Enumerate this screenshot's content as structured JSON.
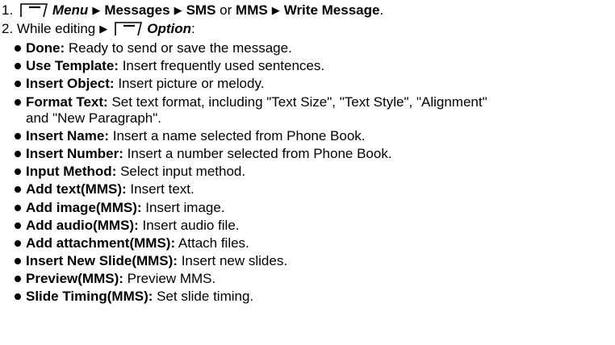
{
  "steps": {
    "one": {
      "number": "1.",
      "menu": "Menu",
      "messages": "Messages",
      "sms": "SMS",
      "or": "or",
      "mms": "MMS",
      "write_message": "Write Message",
      "end": "."
    },
    "two": {
      "number": "2.",
      "while_editing": "While editing",
      "option": "Option",
      "end": ":"
    }
  },
  "options": [
    {
      "term": "Done:",
      "desc": "Ready to send or save the message."
    },
    {
      "term": "Use Template:",
      "desc": "Insert frequently used sentences."
    },
    {
      "term": "Insert Object:",
      "desc": "Insert picture or melody."
    },
    {
      "term": "Format Text:",
      "desc": "Set text format, including \"Text Size\", \"Text Style\", \"Alignment\"",
      "desc2": "and \"New Paragraph\"."
    },
    {
      "term": "Insert Name:",
      "desc": "Insert a name selected from Phone Book."
    },
    {
      "term": "Insert Number:",
      "desc": "Insert a number selected from Phone Book."
    },
    {
      "term": "Input Method:",
      "desc": "Select input method."
    },
    {
      "term": "Add text(MMS):",
      "desc": "Insert text."
    },
    {
      "term": "Add image(MMS):",
      "desc": "Insert image."
    },
    {
      "term": "Add audio(MMS):",
      "desc": "Insert audio file."
    },
    {
      "term": "Add attachment(MMS):",
      "desc": "Attach files."
    },
    {
      "term": "Insert New Slide(MMS):",
      "desc": "Insert new slides."
    },
    {
      "term": "Preview(MMS):",
      "desc": "Preview MMS."
    },
    {
      "term": "Slide Timing(MMS):",
      "desc": "Set slide timing."
    }
  ],
  "icons": {
    "softkey": "left-softkey-icon",
    "arrow": "right-triangle-icon",
    "bullet": "bullet-icon"
  }
}
